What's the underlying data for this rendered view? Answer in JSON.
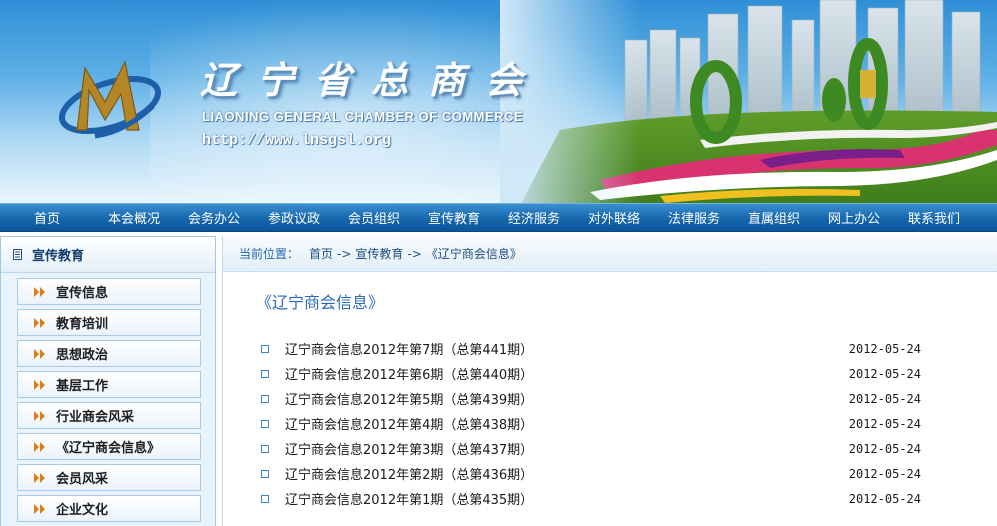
{
  "banner": {
    "title": "辽宁省总商会",
    "subtitle": "LIAONING GENERAL CHAMBER OF COMMERCE",
    "url": "http://www.lnsgsl.org"
  },
  "nav": {
    "items": [
      "首页",
      "本会概况",
      "会务办公",
      "参政议政",
      "会员组织",
      "宣传教育",
      "经济服务",
      "对外联络",
      "法律服务",
      "直属组织",
      "网上办公",
      "联系我们"
    ]
  },
  "sidebar": {
    "title": "宣传教育",
    "items": [
      "宣传信息",
      "教育培训",
      "思想政治",
      "基层工作",
      "行业商会风采",
      "《辽宁商会信息》",
      "会员风采",
      "企业文化"
    ]
  },
  "breadcrumb": {
    "lead": "当前位置：",
    "home": "首页",
    "sep": "->",
    "level1": "宣传教育",
    "level2": "《辽宁商会信息》"
  },
  "main": {
    "heading": "《辽宁商会信息》",
    "articles": [
      {
        "title": "辽宁商会信息2012年第7期（总第441期）",
        "date": "2012-05-24"
      },
      {
        "title": "辽宁商会信息2012年第6期（总第440期）",
        "date": "2012-05-24"
      },
      {
        "title": "辽宁商会信息2012年第5期（总第439期）",
        "date": "2012-05-24"
      },
      {
        "title": "辽宁商会信息2012年第4期（总第438期）",
        "date": "2012-05-24"
      },
      {
        "title": "辽宁商会信息2012年第3期（总第437期）",
        "date": "2012-05-24"
      },
      {
        "title": "辽宁商会信息2012年第2期（总第436期）",
        "date": "2012-05-24"
      },
      {
        "title": "辽宁商会信息2012年第1期（总第435期）",
        "date": "2012-05-24"
      }
    ]
  },
  "colors": {
    "nav_bg": "#1667ad",
    "accent": "#2a6ab8",
    "arrow": "#e07a12"
  }
}
